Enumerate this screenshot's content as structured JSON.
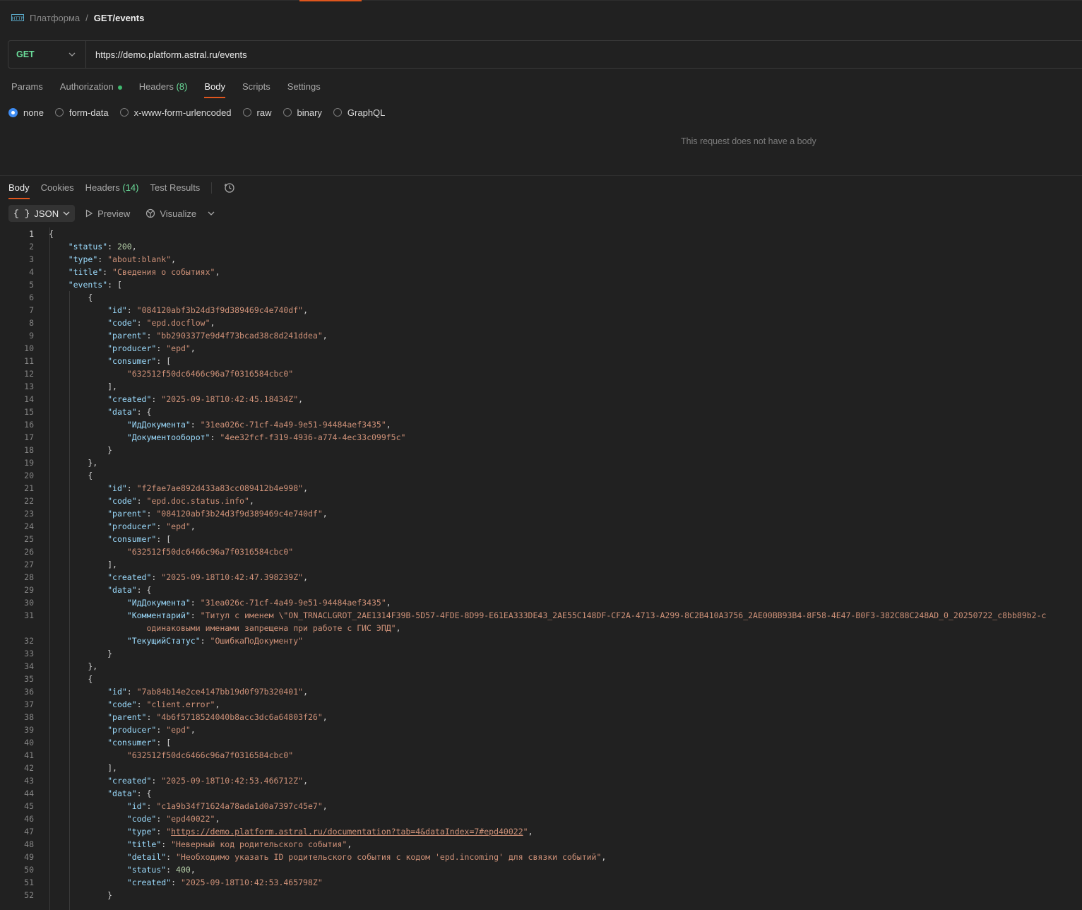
{
  "breadcrumb": {
    "icon": "http-icon",
    "parent": "Платформа",
    "separator": "/",
    "current": "GET/events"
  },
  "request": {
    "method": "GET",
    "url": "https://demo.platform.astral.ru/events",
    "tabs": [
      {
        "label": "Params"
      },
      {
        "label": "Authorization"
      },
      {
        "label": "Headers",
        "count": "(8)"
      },
      {
        "label": "Body"
      },
      {
        "label": "Scripts"
      },
      {
        "label": "Settings"
      }
    ],
    "body_options": [
      "none",
      "form-data",
      "x-www-form-urlencoded",
      "raw",
      "binary",
      "GraphQL"
    ],
    "selected_body_option": "none",
    "empty_message": "This request does not have a body"
  },
  "response": {
    "tabs": [
      {
        "label": "Body"
      },
      {
        "label": "Cookies"
      },
      {
        "label": "Headers",
        "count": "(14)"
      },
      {
        "label": "Test Results"
      }
    ],
    "format": "JSON",
    "format_brace": "{ }",
    "preview_label": "Preview",
    "visualize_label": "Visualize"
  },
  "code_lines": [
    "1",
    "2",
    "3",
    "4",
    "5",
    "6",
    "7",
    "8",
    "9",
    "10",
    "11",
    "12",
    "13",
    "14",
    "15",
    "16",
    "17",
    "18",
    "19",
    "20",
    "21",
    "22",
    "23",
    "24",
    "25",
    "26",
    "27",
    "28",
    "29",
    "30",
    "31",
    "",
    "32",
    "33",
    "34",
    "35",
    "36",
    "37",
    "38",
    "39",
    "40",
    "41",
    "42",
    "43",
    "44",
    "45",
    "46",
    "47",
    "48",
    "49",
    "50",
    "51",
    "52"
  ],
  "json": {
    "status": "200",
    "type": "about:blank",
    "title": "Сведения о событиях",
    "events": [
      {
        "id": "084120abf3b24d3f9d389469c4e740df",
        "code": "epd.docflow",
        "parent": "bb2903377e9d4f73bcad38c8d241ddea",
        "producer": "epd",
        "consumer": "632512f50dc6466c96a7f0316584cbc0",
        "created": "2025-09-18T10:42:45.18434Z",
        "data_doc": "31ea026c-71cf-4a49-9e51-94484aef3435",
        "data_flow": "4ee32fcf-f319-4936-a774-4ec33c099f5c"
      },
      {
        "id": "f2fae7ae892d433a83cc089412b4e998",
        "code": "epd.doc.status.info",
        "parent": "084120abf3b24d3f9d389469c4e740df",
        "producer": "epd",
        "consumer": "632512f50dc6466c96a7f0316584cbc0",
        "created": "2025-09-18T10:42:47.398239Z",
        "data_doc": "31ea026c-71cf-4a49-9e51-94484aef3435",
        "comment_1": "Титул с именем \\\"ON_TRNACLGROT_2AE1314F39B-5D57-4FDE-8D99-E61EA333DE43_2AE55C148DF-CF2A-4713-A299-8C2B410A3756_2AE00BB93B4-8F58-4E47-B0F3-382C88C248AD_0_20250722_c8bb89b2-c",
        "comment_2": "одинаковыми именами запрещена при работе с ГИС ЭПД",
        "status_value": "ОшибкаПоДокументу"
      },
      {
        "id": "7ab84b14e2ce4147bb19d0f97b320401",
        "code": "client.error",
        "parent": "4b6f5718524040b8acc3dc6a64803f26",
        "producer": "epd",
        "consumer": "632512f50dc6466c96a7f0316584cbc0",
        "created": "2025-09-18T10:42:53.466712Z",
        "data_id": "c1a9b34f71624a78ada1d0a7397c45e7",
        "data_code": "epd40022",
        "data_type": "https://demo.platform.astral.ru/documentation?tab=4&dataIndex=7#epd40022",
        "data_title": "Неверный код родительского события",
        "data_detail": "Необходимо указать ID родительского события с кодом 'epd.incoming' для связки событий",
        "data_status": "400",
        "data_created": "2025-09-18T10:42:53.465798Z"
      }
    ]
  },
  "colors": {
    "accent": "#e0561d",
    "method": "#6bdd9a",
    "radio_selected": "#3d8bf2",
    "json_key": "#9cdcfe",
    "json_string": "#ce9178",
    "json_number": "#b5cea8"
  }
}
